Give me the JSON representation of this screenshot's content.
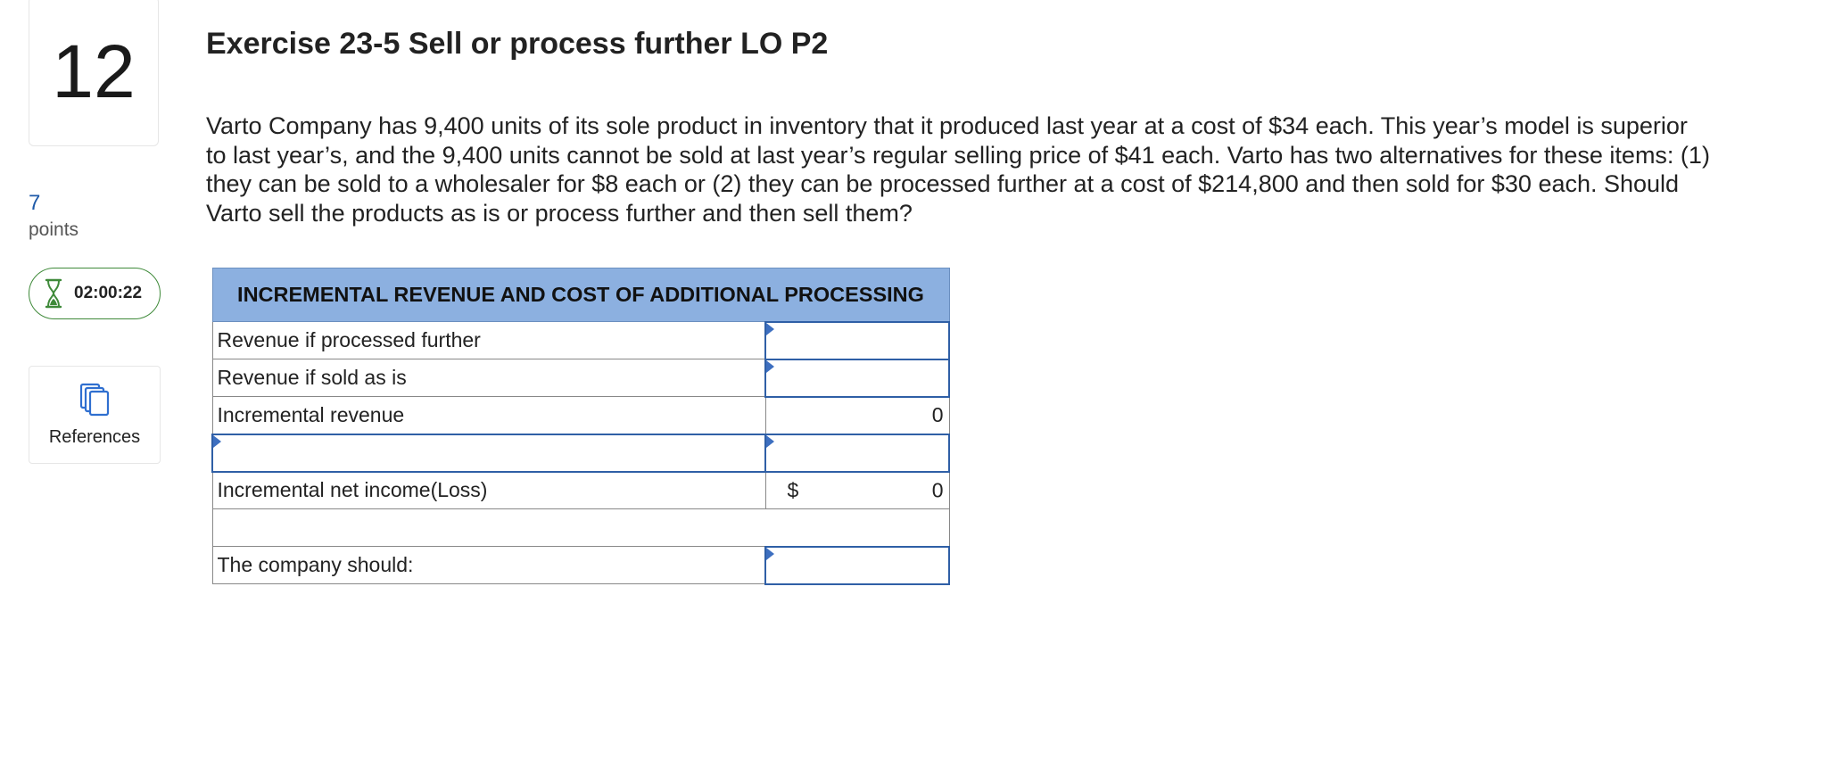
{
  "question": {
    "number": "12",
    "points_value": "7",
    "points_label": "points"
  },
  "timer": {
    "time": "02:00:22",
    "icon": "hourglass-icon",
    "color": "#3f8a3a"
  },
  "references": {
    "label": "References",
    "icon": "copy-documents-icon"
  },
  "exercise": {
    "title": "Exercise 23-5 Sell or process further LO P2",
    "problem_text": "Varto Company has 9,400 units of its sole product in inventory that it produced last year at a cost of $34 each. This year’s model is superior to last year’s, and the 9,400 units cannot be sold at last year’s regular selling price of $41 each. Varto has two alternatives for these items: (1) they can be sold to a wholesaler for $8 each or (2) they can be processed further at a cost of $214,800 and then sold for $30 each. Should Varto sell the products as is or process further and then sell them?"
  },
  "table": {
    "header": "INCREMENTAL REVENUE AND COST OF ADDITIONAL PROCESSING",
    "header_color": "#8cb0e0",
    "rows": {
      "revenue_processed": {
        "label": "Revenue if processed further",
        "value": ""
      },
      "revenue_as_is": {
        "label": "Revenue if sold as is",
        "value": ""
      },
      "incremental_revenue": {
        "label": "Incremental revenue",
        "value": "0"
      },
      "cost_row": {
        "label": "",
        "value": ""
      },
      "net_income": {
        "label": "Incremental net income(Loss)",
        "currency": "$",
        "value": "0"
      },
      "blank": {
        "label": "",
        "value": ""
      },
      "decision": {
        "label": "The company should:",
        "value": ""
      }
    }
  },
  "colors": {
    "accent_blue": "#1e5aa8",
    "input_border": "#2f5fa6"
  }
}
